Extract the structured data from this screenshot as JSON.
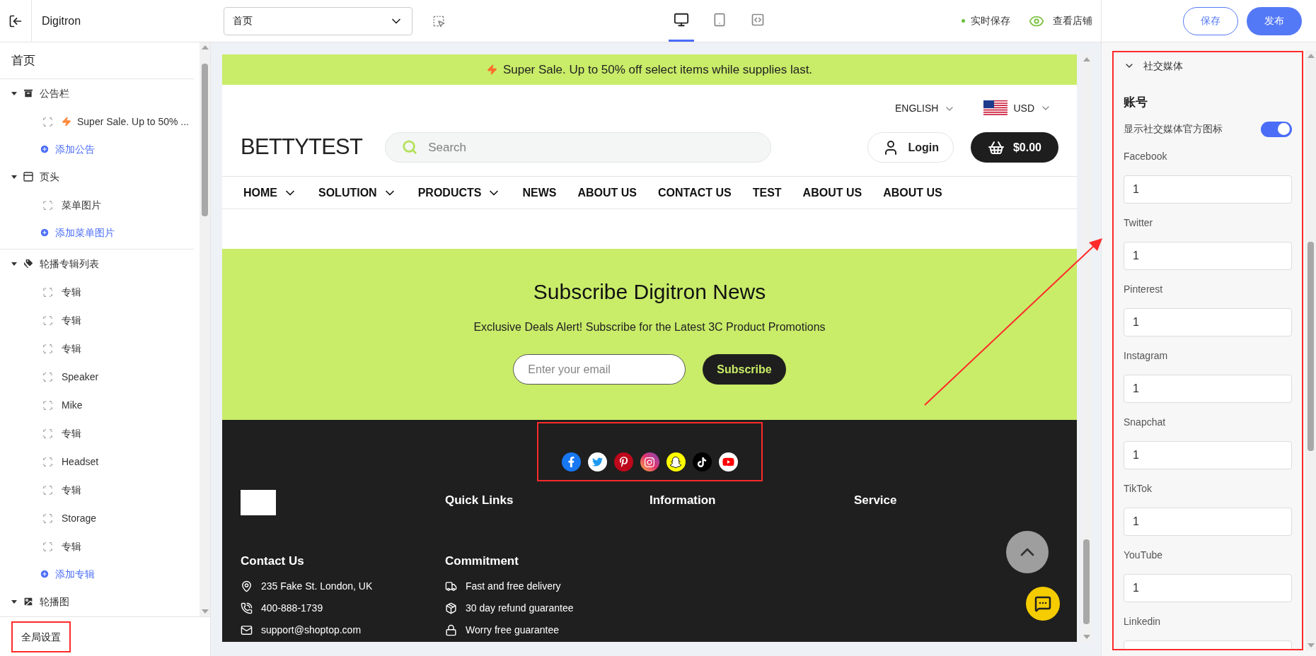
{
  "topbar": {
    "brand": "Digitron",
    "page_select": "首页",
    "devices": [
      {
        "kind": "desktop",
        "selected": true
      },
      {
        "kind": "tablet",
        "selected": false
      },
      {
        "kind": "code",
        "selected": false
      }
    ],
    "autosave": "实时保存",
    "view_store": "查看店铺",
    "buttons": [
      {
        "label": "保存",
        "kind": "outline"
      },
      {
        "label": "发布",
        "kind": "primary"
      }
    ]
  },
  "sidebar": {
    "title": "首页",
    "sections": [
      {
        "label": "公告栏",
        "kind": "archive",
        "expanded": true,
        "children": [
          {
            "label": "Super Sale. Up to 50% ...",
            "bolt": true
          }
        ],
        "add": "添加公告",
        "divider": false
      },
      {
        "label": "页头",
        "kind": "header",
        "expanded": true,
        "children": [
          {
            "label": "菜单图片",
            "bolt": false
          }
        ],
        "add": "添加菜单图片",
        "divider": true
      },
      {
        "label": "轮播专辑列表",
        "kind": "tags",
        "expanded": true,
        "children": [
          {
            "label": "专辑",
            "bolt": false
          },
          {
            "label": "专辑",
            "bolt": false
          },
          {
            "label": "专辑",
            "bolt": false
          },
          {
            "label": "Speaker",
            "bolt": false
          },
          {
            "label": "Mike",
            "bolt": false
          },
          {
            "label": "专辑",
            "bolt": false
          },
          {
            "label": "Headset",
            "bolt": false
          },
          {
            "label": "专辑",
            "bolt": false
          },
          {
            "label": "Storage",
            "bolt": false
          },
          {
            "label": "专辑",
            "bolt": false
          }
        ],
        "add": "添加专辑",
        "divider": false
      },
      {
        "label": "轮播图",
        "kind": "image",
        "expanded": true,
        "divider": false
      }
    ],
    "footer": "全局设置"
  },
  "preview": {
    "announcement": "Super Sale. Up to 50% off select items while supplies last.",
    "language": "ENGLISH",
    "currency": "USD",
    "logo": "BETTYTEST",
    "search_placeholder": "Search",
    "login": "Login",
    "cart": "$0.00",
    "nav": [
      {
        "label": "HOME",
        "dropdown": true
      },
      {
        "label": "SOLUTION",
        "dropdown": true
      },
      {
        "label": "PRODUCTS",
        "dropdown": true
      },
      {
        "label": "NEWS",
        "dropdown": false
      },
      {
        "label": "ABOUT US",
        "dropdown": false
      },
      {
        "label": "CONTACT US",
        "dropdown": false
      },
      {
        "label": "TEST",
        "dropdown": false
      },
      {
        "label": "ABOUT US",
        "dropdown": false
      },
      {
        "label": "ABOUT US",
        "dropdown": false
      }
    ],
    "subscribe": {
      "title": "Subscribe Digitron News",
      "subtitle": "Exclusive Deals Alert! Subscribe for the Latest 3C Product Promotions",
      "placeholder": "Enter your email",
      "button": "Subscribe"
    },
    "social": [
      {
        "kind": "facebook"
      },
      {
        "kind": "twitter"
      },
      {
        "kind": "pinterest"
      },
      {
        "kind": "instagram"
      },
      {
        "kind": "snapchat"
      },
      {
        "kind": "tiktok"
      },
      {
        "kind": "youtube"
      }
    ],
    "footer_columns": [
      "Quick Links",
      "Information",
      "Service"
    ],
    "contact": {
      "title": "Contact Us",
      "items": [
        {
          "kind": "location",
          "text": "235 Fake St. London, UK"
        },
        {
          "kind": "phone",
          "text": "400-888-1739"
        },
        {
          "kind": "mail",
          "text": "support@shoptop.com"
        }
      ]
    },
    "commitment": {
      "title": "Commitment",
      "items": [
        {
          "kind": "truck",
          "text": "Fast and free delivery"
        },
        {
          "kind": "box",
          "text": "30 day refund guarantee"
        },
        {
          "kind": "lock",
          "text": "Worry free guarantee"
        }
      ]
    }
  },
  "settings": {
    "section": "社交媒体",
    "expanded": true,
    "heading": "账号",
    "toggle": {
      "label": "显示社交媒体官方图标",
      "on": true
    },
    "fields": [
      {
        "label": "Facebook",
        "value": "1"
      },
      {
        "label": "Twitter",
        "value": "1"
      },
      {
        "label": "Pinterest",
        "value": "1"
      },
      {
        "label": "Instagram",
        "value": "1"
      },
      {
        "label": "Snapchat",
        "value": "1"
      },
      {
        "label": "TikTok",
        "value": "1"
      },
      {
        "label": "YouTube",
        "value": "1"
      },
      {
        "label": "Linkedin"
      }
    ]
  }
}
